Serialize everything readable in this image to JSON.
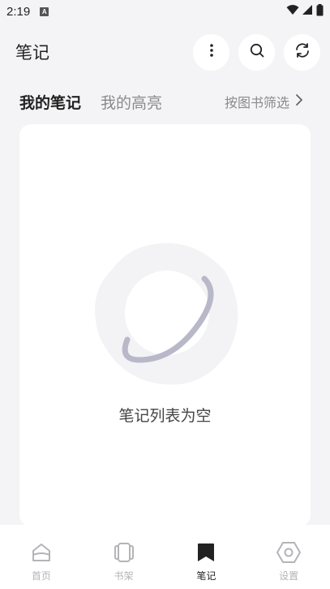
{
  "status_bar": {
    "time": "2:19",
    "notification_badge": "A",
    "icons": [
      "wifi-icon",
      "signal-icon",
      "battery-icon"
    ]
  },
  "header": {
    "title": "笔记",
    "actions": [
      "more-vert-icon",
      "search-icon",
      "sync-icon"
    ]
  },
  "tabs": [
    {
      "label": "我的笔记",
      "active": true
    },
    {
      "label": "我的高亮",
      "active": false
    }
  ],
  "filter": {
    "label": "按图书筛选",
    "icon": "chevron-right-icon"
  },
  "empty_state": {
    "message": "笔记列表为空",
    "icon": "planet-icon"
  },
  "bottom_nav": [
    {
      "label": "首页",
      "icon": "home-icon",
      "active": false
    },
    {
      "label": "书架",
      "icon": "bookshelf-icon",
      "active": false
    },
    {
      "label": "笔记",
      "icon": "bookmark-icon",
      "active": true
    },
    {
      "label": "设置",
      "icon": "settings-hexagon-icon",
      "active": false
    }
  ],
  "colors": {
    "background": "#f4f4f6",
    "card": "#ffffff",
    "text_primary": "#222222",
    "text_muted": "#8a8a8e",
    "nav_inactive": "#b4b4b8",
    "illustration_ring": "#b9b8c8"
  }
}
